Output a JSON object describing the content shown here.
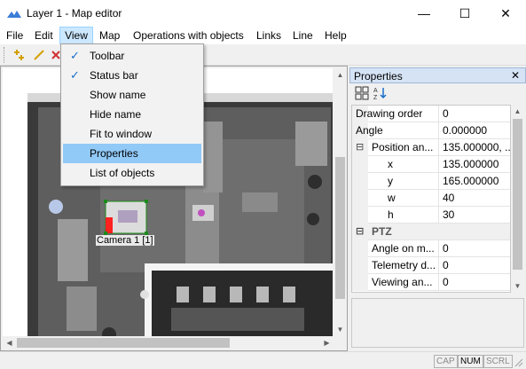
{
  "window": {
    "title": "Layer 1 - Map editor",
    "minimize_glyph": "—",
    "maximize_glyph": "☐",
    "close_glyph": "✕"
  },
  "menubar": [
    "File",
    "Edit",
    "View",
    "Map",
    "Operations with objects",
    "Links",
    "Line",
    "Help"
  ],
  "view_menu": {
    "items": [
      {
        "label": "Toolbar",
        "checked": true
      },
      {
        "label": "Status bar",
        "checked": true
      },
      {
        "label": "Show name",
        "checked": false
      },
      {
        "label": "Hide name",
        "checked": false
      },
      {
        "label": "Fit to window",
        "checked": false
      },
      {
        "label": "Properties",
        "checked": false,
        "highlighted": true
      },
      {
        "label": "List of objects",
        "checked": false
      }
    ],
    "check_glyph": "✓"
  },
  "map": {
    "camera_label": "Camera 1 [1]"
  },
  "properties": {
    "title": "Properties",
    "close_glyph": "✕",
    "rows": [
      {
        "name": "Drawing order",
        "value": "0"
      },
      {
        "name": "Angle",
        "value": "0.000000"
      },
      {
        "name": "Position an...",
        "value": "135.000000, ...",
        "expander": "⊟"
      },
      {
        "name": "x",
        "value": "135.000000",
        "indent": true
      },
      {
        "name": "y",
        "value": "165.000000",
        "indent": true
      },
      {
        "name": "w",
        "value": "40",
        "indent": true
      },
      {
        "name": "h",
        "value": "30",
        "indent": true
      },
      {
        "name": "PTZ",
        "value": "",
        "category": true,
        "expander": "⊟"
      },
      {
        "name": "Angle on m...",
        "value": "0"
      },
      {
        "name": "Telemetry d...",
        "value": "0"
      },
      {
        "name": "Viewing an...",
        "value": "0"
      }
    ]
  },
  "statusbar": {
    "cap": "CAP",
    "num": "NUM",
    "scrl": "SCRL"
  },
  "colors": {
    "menu_highlight": "#91c9f7",
    "panel_header": "#d5e3f5",
    "check": "#1a6fc8"
  }
}
